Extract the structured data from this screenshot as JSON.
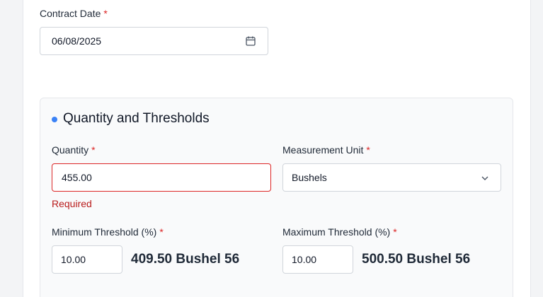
{
  "contract_date": {
    "label": "Contract Date",
    "required_mark": "*",
    "value": "06/08/2025",
    "icon": "calendar-icon"
  },
  "section": {
    "title": "Quantity and Thresholds",
    "bullet_color": "#3b82f6",
    "quantity": {
      "label": "Quantity",
      "required_mark": "*",
      "value": "455.00",
      "error": "Required"
    },
    "measurement_unit": {
      "label": "Measurement Unit",
      "required_mark": "*",
      "selected": "Bushels",
      "icon": "chevron-down-icon"
    },
    "min_threshold": {
      "label": "Minimum Threshold (%)",
      "required_mark": "*",
      "value": "10.00",
      "computed": "409.50 Bushel 56"
    },
    "max_threshold": {
      "label": "Maximum Threshold (%)",
      "required_mark": "*",
      "value": "10.00",
      "computed": "500.50 Bushel 56"
    }
  }
}
